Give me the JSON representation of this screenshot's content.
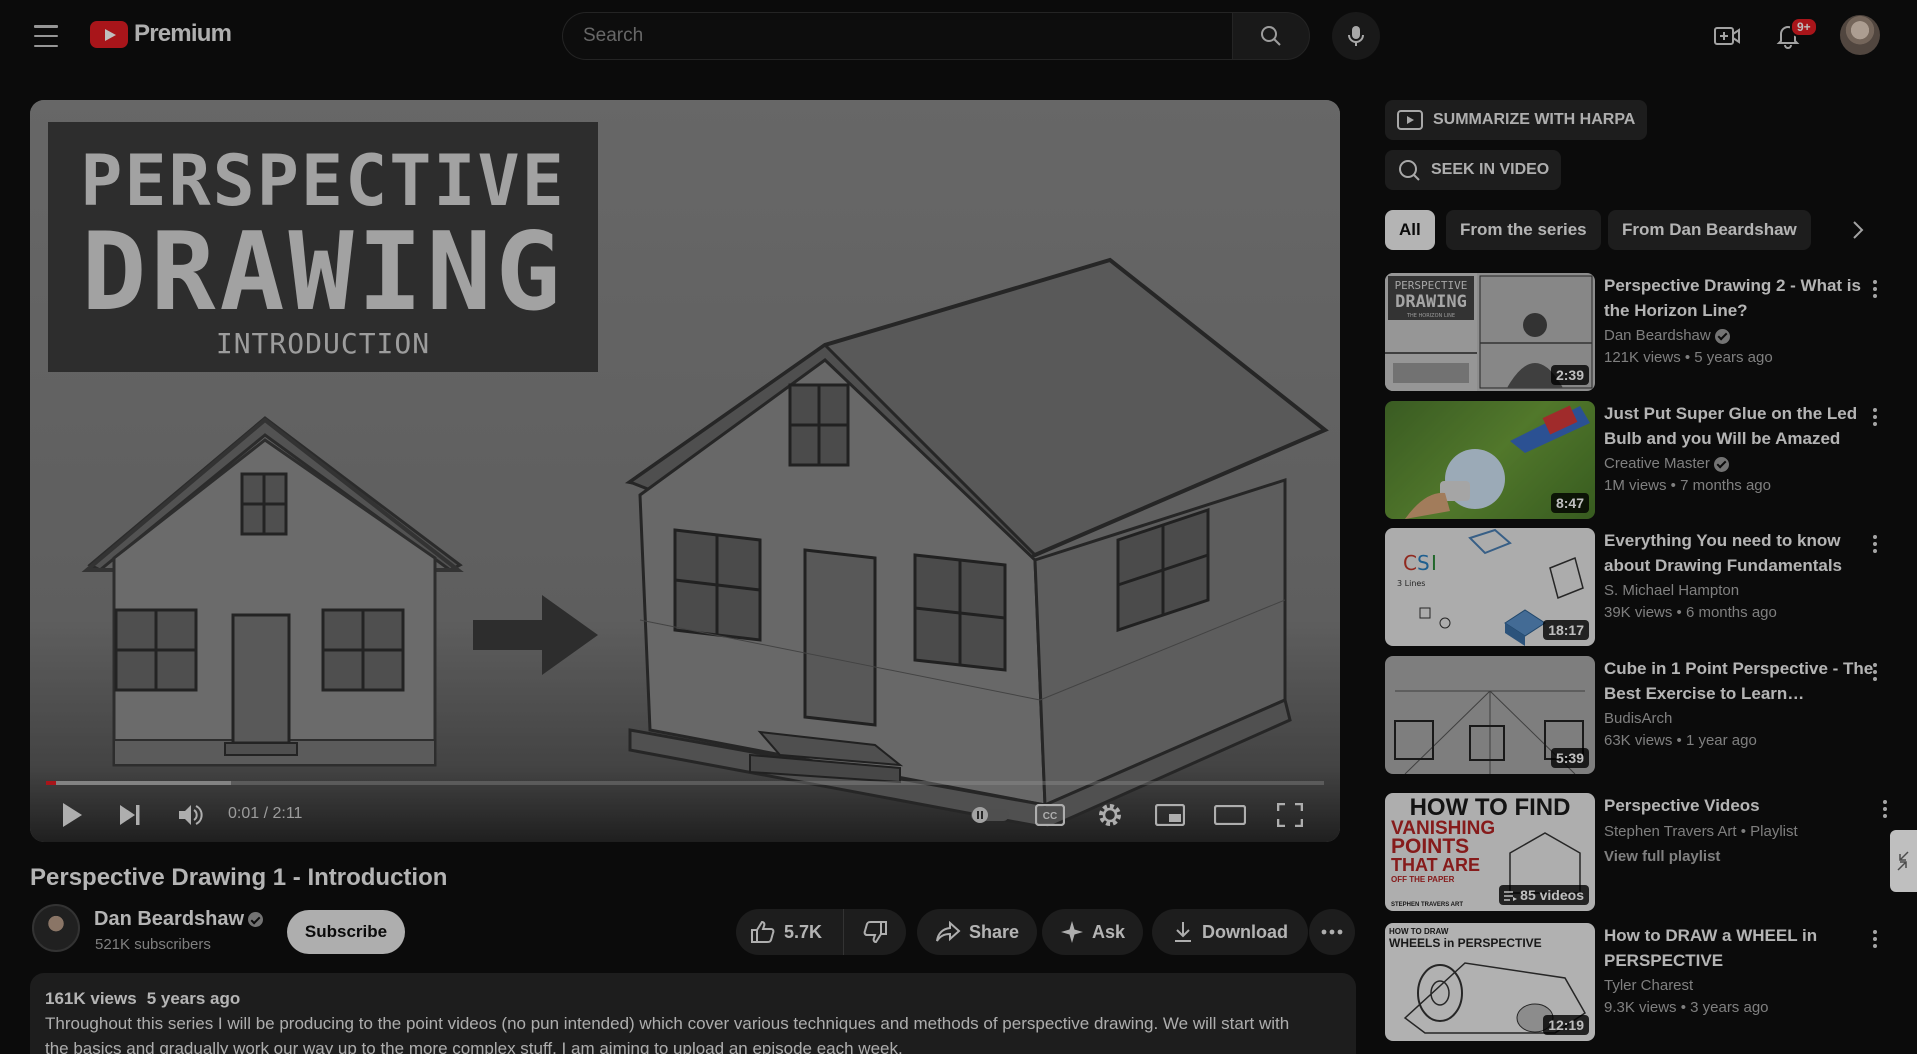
{
  "header": {
    "logo_text": "Premium",
    "search_placeholder": "Search",
    "notification_count": "9+"
  },
  "player": {
    "title_card": {
      "line1": "PERSPECTIVE",
      "line2": "DRAWING",
      "line3": "INTRODUCTION"
    },
    "time": "0:01 / 2:11",
    "progress_played_fraction": 0.008,
    "progress_loaded_fraction": 0.145
  },
  "video": {
    "title": "Perspective Drawing 1 - Introduction",
    "channel": "Dan Beardshaw",
    "subscribers": "521K subscribers",
    "subscribe_label": "Subscribe",
    "likes": "5.7K",
    "share_label": "Share",
    "ask_label": "Ask",
    "download_label": "Download",
    "views": "161K views",
    "age": "5 years ago",
    "description_line1": "Throughout this series I will be producing to the point videos (no pun intended) which cover various techniques and methods of perspective drawing. We will start with",
    "description_line2": "the basics and gradually work our way up to the more complex stuff. I am aiming to upload an episode each week."
  },
  "sidebar": {
    "harpa_label": "SUMMARIZE WITH HARPA",
    "seek_label": "SEEK IN VIDEO",
    "chips": [
      "All",
      "From the series",
      "From Dan Beardshaw"
    ],
    "recommendations": [
      {
        "title": "Perspective Drawing 2 - What is the Horizon Line?",
        "channel": "Dan Beardshaw",
        "verified": true,
        "meta": "121K views • 5 years ago",
        "duration": "2:39"
      },
      {
        "title": "Just Put Super Glue on the Led Bulb and you Will be Amazed",
        "channel": "Creative Master",
        "verified": true,
        "meta": "1M views • 7 months ago",
        "duration": "8:47"
      },
      {
        "title": "Everything You need to know about Drawing Fundamentals",
        "channel": "S. Michael Hampton",
        "verified": false,
        "meta": "39K views • 6 months ago",
        "duration": "18:17"
      },
      {
        "title": "Cube in 1 Point Perspective - The Best Exercise to Learn…",
        "channel": "BudisArch",
        "verified": false,
        "meta": "63K views • 1 year ago",
        "duration": "5:39"
      },
      {
        "title": "Perspective Videos",
        "channel": "Stephen Travers Art • Playlist",
        "verified": false,
        "meta": "View full playlist",
        "duration": "85 videos"
      },
      {
        "title": "How to DRAW a WHEEL in PERSPECTIVE",
        "channel": "Tyler Charest",
        "verified": false,
        "meta": "9.3K views • 3 years ago",
        "duration": "12:19"
      }
    ],
    "thumb_texts": {
      "t1_left_l1": "PERSPECTIVE",
      "t1_left_l2": "DRAWING",
      "t1_left_l3": "THE HORIZON LINE",
      "t3_label": "3 Lines",
      "t5_l1": "HOW TO FIND",
      "t5_l2": "VANISHING",
      "t5_l3": "POINTS",
      "t5_l4": "THAT ARE",
      "t5_l5": "OFF THE PAPER",
      "t5_l6": "STEPHEN TRAVERS ART",
      "t6_l1": "HOW TO DRAW",
      "t6_l2": "WHEELS in PERSPECTIVE"
    }
  },
  "colors": {
    "background": "#0f0f0f",
    "accent_red": "#e11d23",
    "chip_bg": "#272727"
  },
  "icons": [
    "menu-icon",
    "search-icon",
    "mic-icon",
    "create-icon",
    "bell-icon",
    "play-icon",
    "next-icon",
    "volume-icon",
    "autoplay-toggle-icon",
    "cc-icon",
    "gear-icon",
    "miniplayer-icon",
    "theater-icon",
    "fullscreen-icon",
    "thumbs-up-icon",
    "thumbs-down-icon",
    "share-icon",
    "sparkle-icon",
    "download-icon",
    "more-icon",
    "chevron-right-icon",
    "playlist-icon"
  ]
}
